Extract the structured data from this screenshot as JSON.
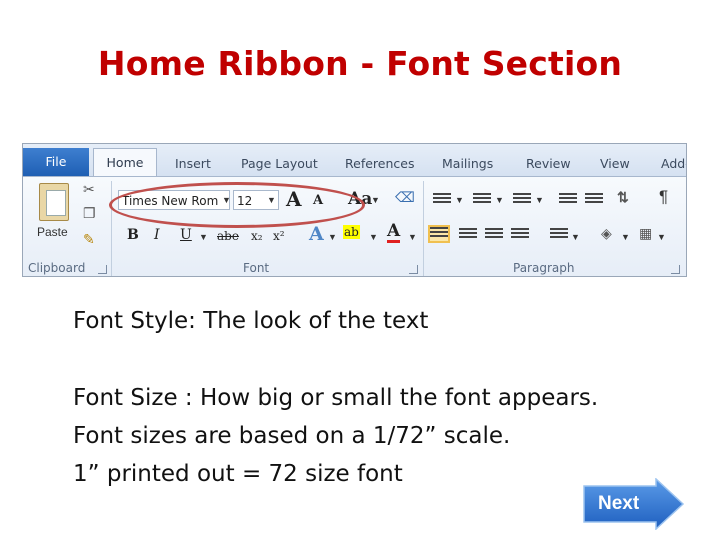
{
  "slide": {
    "title": "Home Ribbon - Font Section"
  },
  "ribbon": {
    "tabs": [
      "File",
      "Home",
      "Insert",
      "Page Layout",
      "References",
      "Mailings",
      "Review",
      "View",
      "Add-"
    ],
    "clipboard": {
      "paste_label": "Paste",
      "group_label": "Clipboard"
    },
    "font": {
      "font_name": "Times New Rom",
      "font_size": "12",
      "group_label": "Font",
      "bold": "B",
      "italic": "I",
      "underline": "U",
      "strike": "abe",
      "grow": "A",
      "shrink": "A",
      "change_case": "Aa",
      "highlight": "ab",
      "font_color": "A"
    },
    "paragraph": {
      "group_label": "Paragraph",
      "pilcrow": "¶"
    },
    "accent_color": "#c0504d"
  },
  "content": {
    "line1": "Font Style: The look of the text",
    "line2": "Font Size : How big or small the font appears.",
    "line3": "Font sizes are based on a 1/72” scale.",
    "line4": "1” printed out = 72 size font"
  },
  "next_button": {
    "label": "Next",
    "color": "#2e75d6"
  }
}
